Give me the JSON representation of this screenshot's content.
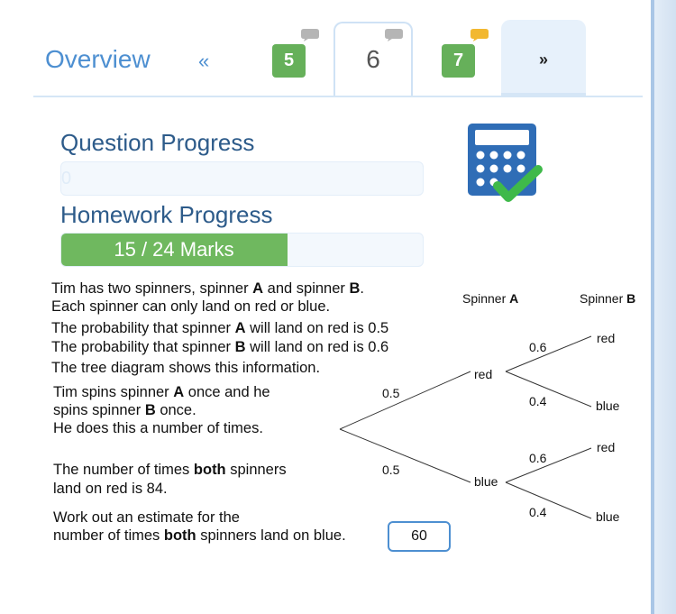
{
  "tabs": {
    "overview_label": "Overview",
    "prev_label": "«",
    "next_label": "»",
    "questions": [
      {
        "label": "5",
        "comment_color": "#b5b5b5"
      },
      {
        "label": "6",
        "comment_color": "#b5b5b5"
      },
      {
        "label": "7",
        "comment_color": "#f2b830"
      }
    ]
  },
  "question_progress": {
    "title": "Question Progress",
    "value_text": "0",
    "fraction": 0
  },
  "homework_progress": {
    "title": "Homework Progress",
    "marks_text": "15 / 24 Marks",
    "fraction": 0.625
  },
  "calculator": {
    "icon": "calculator-allowed-icon"
  },
  "question": {
    "line1_a": "Tim has two spinners, spinner ",
    "line1_b": "A",
    "line1_c": " and spinner ",
    "line1_d": "B",
    "line1_e": ".",
    "line2": "Each spinner can only land on red or blue.",
    "line3_a": "The probability that spinner ",
    "line3_b": "A",
    "line3_c": " will land on red is 0.5",
    "line4_a": "The probability that spinner ",
    "line4_b": "B",
    "line4_c": " will land on red is 0.6",
    "line5": "The tree diagram shows this information.",
    "spin1_a": "Tim spins spinner ",
    "spin1_b": "A",
    "spin1_c": " once and he",
    "spin2_a": "spins spinner ",
    "spin2_b": "B",
    "spin2_c": " once.",
    "spin3": "He does this a number of times.",
    "both1_a": "The number of times ",
    "both1_b": "both",
    "both1_c": " spinners",
    "both2": "land on red is 84.",
    "work1": "Work out an estimate for the",
    "work2_a": "number of times ",
    "work2_b": "both",
    "work2_c": " spinners land on blue.",
    "answer_value": "60"
  },
  "tree": {
    "header_a_prefix": "Spinner ",
    "header_a_letter": "A",
    "header_b_prefix": "Spinner ",
    "header_b_letter": "B",
    "first_red_prob": "0.5",
    "first_blue_prob": "0.5",
    "first_red_label": "red",
    "first_blue_label": "blue",
    "red_red_prob": "0.6",
    "red_blue_prob": "0.4",
    "blue_red_prob": "0.6",
    "blue_blue_prob": "0.4",
    "second_red_label_1": "red",
    "second_blue_label_1": "blue",
    "second_red_label_2": "red",
    "second_blue_label_2": "blue"
  },
  "colors": {
    "accent": "#4d8fd1",
    "badge_green": "#66b05a",
    "progress_green": "#6fb85f",
    "title_blue": "#2d5b8a"
  }
}
